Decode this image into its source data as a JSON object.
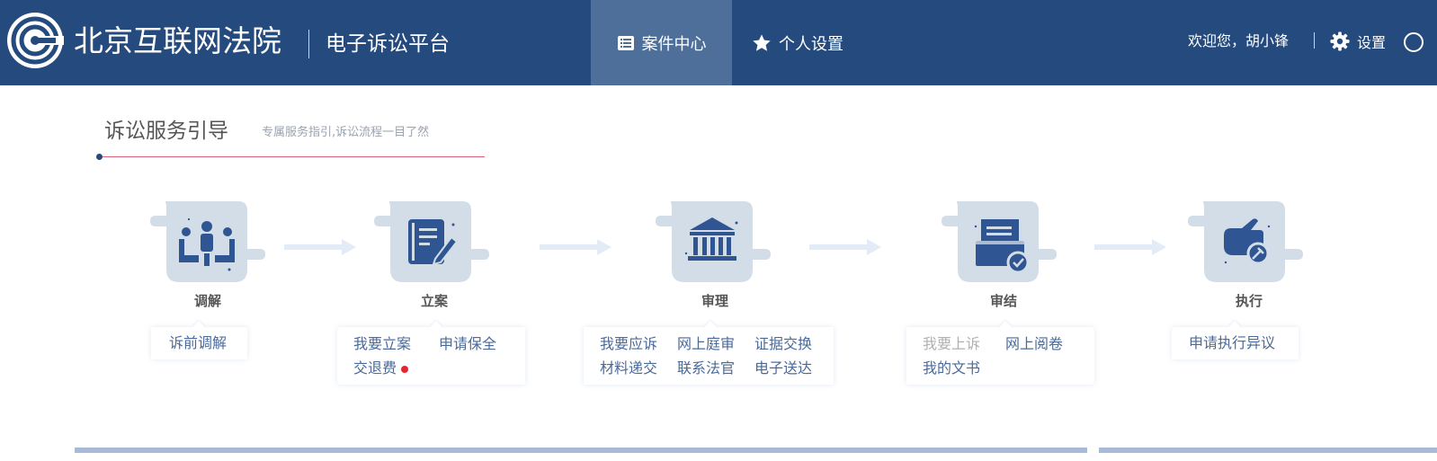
{
  "header": {
    "brand": "北京互联网法院",
    "platform": "电子诉讼平台",
    "nav": [
      {
        "label": "案件中心",
        "icon": "list-icon",
        "active": true
      },
      {
        "label": "个人设置",
        "icon": "star-icon",
        "active": false
      }
    ],
    "welcome": "欢迎您，胡小锋",
    "settings_label": "设置"
  },
  "section": {
    "title": "诉讼服务引导",
    "subtitle": "专属服务指引,诉讼流程一目了然"
  },
  "steps": [
    {
      "label": "调解",
      "icon": "meeting-icon",
      "links": [
        {
          "text": "诉前调解"
        }
      ]
    },
    {
      "label": "立案",
      "icon": "document-edit-icon",
      "links": [
        {
          "text": "我要立案"
        },
        {
          "text": "申请保全"
        },
        {
          "text": "交退费",
          "badge": "red-dot"
        }
      ]
    },
    {
      "label": "审理",
      "icon": "courthouse-icon",
      "links": [
        {
          "text": "我要应诉"
        },
        {
          "text": "网上庭审"
        },
        {
          "text": "证据交换"
        },
        {
          "text": "材料递交"
        },
        {
          "text": "联系法官"
        },
        {
          "text": "电子送达"
        }
      ]
    },
    {
      "label": "审结",
      "icon": "verdict-check-icon",
      "links": [
        {
          "text": "我要上诉",
          "disabled": true
        },
        {
          "text": "网上阅卷"
        },
        {
          "text": "我的文书"
        }
      ]
    },
    {
      "label": "执行",
      "icon": "hand-gavel-icon",
      "links": [
        {
          "text": "申请执行异议"
        }
      ]
    }
  ],
  "colors": {
    "header_bg": "#244a7e",
    "nav_active_bg": "#4e6f99",
    "link": "#4a6a9a",
    "accent_line": "#d9627a",
    "badge": "#e8252f"
  }
}
